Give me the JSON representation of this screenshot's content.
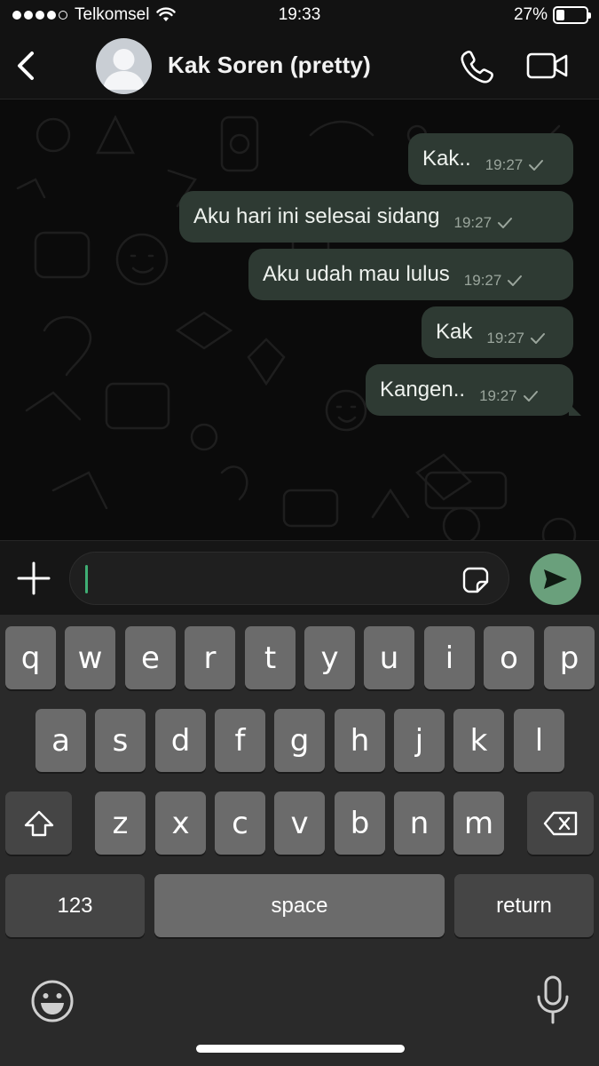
{
  "status_bar": {
    "carrier": "Telkomsel",
    "time": "19:33",
    "battery_percent": "27%",
    "battery_level": 0.27,
    "signal_bars": 4,
    "signal_max": 5
  },
  "header": {
    "contact_name": "Kak Soren (pretty)",
    "icons": [
      "back-chevron-icon",
      "avatar-placeholder",
      "phone-icon",
      "video-camera-icon"
    ]
  },
  "messages": [
    {
      "text": "Kak..",
      "time": "19:27",
      "status": "sent",
      "direction": "outgoing"
    },
    {
      "text": "Aku hari ini selesai sidang",
      "time": "19:27",
      "status": "sent",
      "direction": "outgoing"
    },
    {
      "text": "Aku udah mau lulus",
      "time": "19:27",
      "status": "sent",
      "direction": "outgoing"
    },
    {
      "text": "Kak",
      "time": "19:27",
      "status": "sent",
      "direction": "outgoing"
    },
    {
      "text": "Kangen..",
      "time": "19:27",
      "status": "sent",
      "direction": "outgoing"
    }
  ],
  "composer": {
    "value": "",
    "icons": [
      "plus-icon",
      "sticker-icon",
      "send-icon"
    ]
  },
  "keyboard": {
    "row1": [
      "q",
      "w",
      "e",
      "r",
      "t",
      "y",
      "u",
      "i",
      "o",
      "p"
    ],
    "row2": [
      "a",
      "s",
      "d",
      "f",
      "g",
      "h",
      "j",
      "k",
      "l"
    ],
    "row3": [
      "z",
      "x",
      "c",
      "v",
      "b",
      "n",
      "m"
    ],
    "numbers_key": "123",
    "space_key": "space",
    "return_key": "return"
  },
  "colors": {
    "bubble": "#2e3a33",
    "send_button": "#6aa07c",
    "cursor": "#3fae74",
    "background": "#0b0b0b"
  }
}
